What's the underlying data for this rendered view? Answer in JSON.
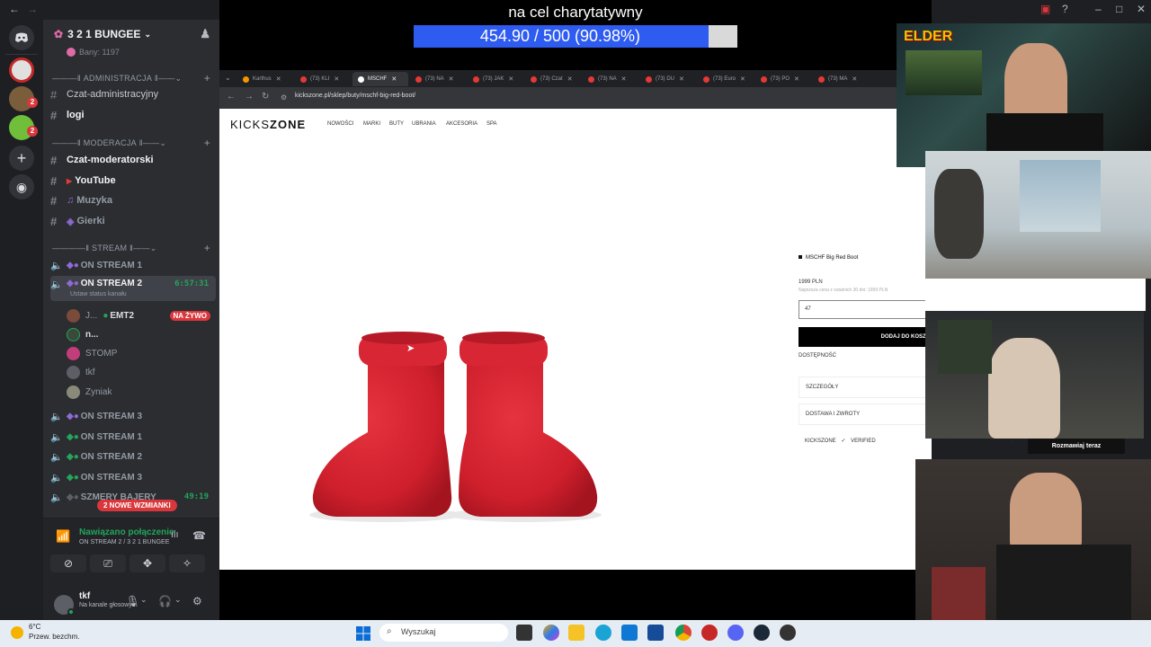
{
  "discord": {
    "server_name": "3 2 1 BUNGEE",
    "top_partial": "Bany: 1197",
    "categories": {
      "admin": "ADMINISTRACJA",
      "mod": "MODERACJA",
      "stream": "STREAM"
    },
    "text_channels": {
      "czat_admin": "Czat-administracyjny",
      "logi": "logi",
      "czat_mod": "Czat-moderatorski",
      "youtube": "YouTube",
      "muzyka": "Muzyka",
      "gierki": "Gierki"
    },
    "voice_channels": [
      {
        "label": "ON STREAM 1"
      },
      {
        "label": "ON STREAM 2",
        "timer": "6:57:31",
        "status": "Ustaw status kanału"
      },
      {
        "label": "ON STREAM 3"
      },
      {
        "label": "ON STREAM 1"
      },
      {
        "label": "ON STREAM 2"
      },
      {
        "label": "ON STREAM 3"
      },
      {
        "label": "SZMERY BAJERY",
        "timer": "49:19"
      }
    ],
    "voice_users": [
      {
        "name": "J...",
        "extra": "EMT2",
        "live": "NA ŻYWO"
      },
      {
        "name": "n..."
      },
      {
        "name": "STOMP"
      },
      {
        "name": "tkf"
      },
      {
        "name": "Zyniak"
      }
    ],
    "mentions_badge": "2 NOWE WZMIANKI",
    "connection": {
      "title": "Nawiązano połączenie",
      "subtitle": "ON STREAM 2 / 3 2 1 BUNGEE"
    },
    "user": {
      "name": "tkf",
      "status": "Na kanale głosowym"
    }
  },
  "overlay": {
    "charity_title": "na cel charytatywny",
    "progress_text": "454.90 / 500 (90.98%)",
    "progress_ratio": 0.9098
  },
  "browser": {
    "tabs": [
      "Karthus",
      "(73) KLI",
      "MSCHF",
      "(73) NA",
      "(73) JAK",
      "(73) Czat",
      "(73) NA",
      "(73) DU",
      "(73) Euro",
      "(73) PO",
      "(73) MA"
    ],
    "url": "kickszone.pl/sklep/buty/mschf-big-red-boot/",
    "site": {
      "logo_a": "KICKS",
      "logo_b": "ZONE",
      "menu": [
        "NOWOŚCI",
        "MARKI",
        "BUTY",
        "UBRANIA",
        "AKCESORIA",
        "SPA"
      ],
      "product_name": "MSCHF Big Red Boot",
      "price": "1999 PLN",
      "price_note": "Najniższa cena z ostatnich 30 dni: 1999 PLN",
      "size_selected": "47",
      "add_to_cart": "DODAJ DO KOSZYKA",
      "availability": "DOSTĘPNOŚĆ",
      "accordion": [
        "SZCZEGÓŁY",
        "DOSTAWA I ZWROTY"
      ],
      "verified_logo": "KICKSZONE",
      "verified": "VERIFIED"
    }
  },
  "cams": {
    "elder_label": "ELDER",
    "talk_button": "Rozmawiaj teraz"
  },
  "taskbar": {
    "temp": "6°C",
    "weather": "Przew. bezchm.",
    "search_placeholder": "Wyszukaj"
  },
  "colors": {
    "discord_bg": "#2b2d31",
    "progress_fill": "#2e5bf0",
    "boot_red": "#d4202e",
    "live_red": "#da373c",
    "voice_green": "#23a55a"
  }
}
